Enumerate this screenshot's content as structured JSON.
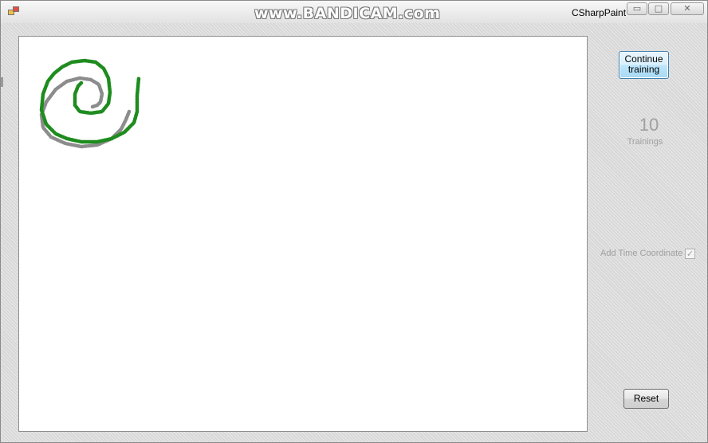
{
  "watermark": {
    "text": "www.BANDICAM.com"
  },
  "window": {
    "title": "CSharpPaint",
    "controls": {
      "minimize": "▭",
      "maximize": "□",
      "close": "✕"
    }
  },
  "sidebar": {
    "continue_button": "Continue training",
    "trainings_count": "10",
    "trainings_label": "Trainings",
    "time_coordinate_label": "Add Time Coordinate",
    "time_coordinate_checked": true,
    "time_coordinate_mark": "✓",
    "reset_button": "Reset"
  },
  "canvas": {
    "strokes": [
      {
        "name": "reference-spiral",
        "color": "#8c8c8c"
      },
      {
        "name": "drawn-spiral",
        "color": "#1e8c1e"
      }
    ]
  }
}
